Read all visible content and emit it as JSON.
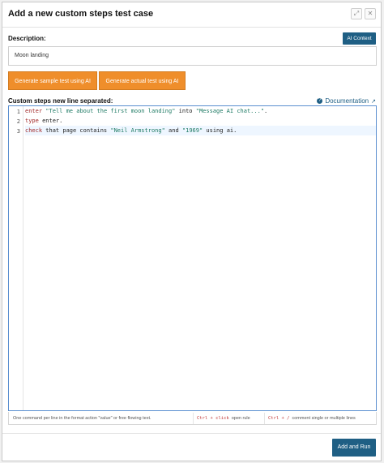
{
  "modal": {
    "title": "Add a new custom steps test case",
    "description_label": "Description:",
    "ai_context_label": "AI Context",
    "description_value": "Moon landing",
    "generate_sample_label": "Generate sample test using AI",
    "generate_actual_label": "Generate actual test using AI",
    "steps_label": "Custom steps new line separated:",
    "documentation_label": "Documentation",
    "footer": {
      "hint_format": "One command per line in the format action \"value\" or free flowing text.",
      "hint_click_key": "Ctrl + click",
      "hint_click_text": "open rule",
      "hint_comment_key": "Ctrl + /",
      "hint_comment_text": "comment single or multiple lines"
    },
    "add_run_label": "Add and Run"
  },
  "editor": {
    "line_numbers": [
      "1",
      "2",
      "3"
    ],
    "lines": [
      {
        "kw": "enter",
        "t1": " ",
        "s1": "\"Tell me about the first moon landing\"",
        "t2": " into ",
        "s2": "\"Message AI chat...\"",
        "t3": "."
      },
      {
        "kw": "type",
        "t1": " enter.",
        "s1": "",
        "t2": "",
        "s2": "",
        "t3": ""
      },
      {
        "kw": "check",
        "t1": " that page contains ",
        "s1": "\"Neil Armstrong\"",
        "t2": " and ",
        "s2": "\"1969\"",
        "t3": " using ai."
      }
    ]
  }
}
